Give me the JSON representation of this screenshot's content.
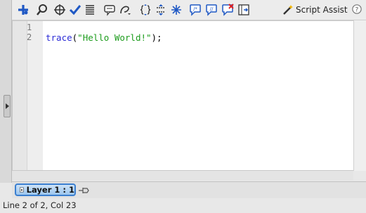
{
  "toolbar": {
    "buttons": [
      {
        "icon": "add-statement-icon"
      },
      {
        "icon": "find-icon"
      },
      {
        "icon": "insert-target-path-icon"
      },
      {
        "icon": "check-syntax-icon"
      },
      {
        "icon": "auto-format-icon"
      },
      {
        "icon": "show-code-hint-icon"
      },
      {
        "icon": "debug-options-icon"
      },
      {
        "icon": "collapse-between-braces-icon"
      },
      {
        "icon": "collapse-selection-icon"
      },
      {
        "icon": "expand-all-icon"
      },
      {
        "icon": "apply-block-comment-icon"
      },
      {
        "icon": "apply-line-comment-icon"
      },
      {
        "icon": "remove-comment-icon"
      },
      {
        "icon": "show-hide-toolbox-icon"
      }
    ],
    "script_assist_label": "Script Assist",
    "help_icon": "help-icon"
  },
  "editor": {
    "lines": [
      {
        "number": "1",
        "code": ""
      },
      {
        "number": "2",
        "func": "trace",
        "open": "(",
        "string": "\"Hello World!\"",
        "close": ");"
      }
    ]
  },
  "tabs": {
    "layer_tab_label": "Layer 1 : 1"
  },
  "status": {
    "text": "Line 2 of 2, Col 23"
  },
  "colors": {
    "keyword": "#2b2bd6",
    "string": "#1d9c1d",
    "tab_border": "#3b7fd0"
  }
}
